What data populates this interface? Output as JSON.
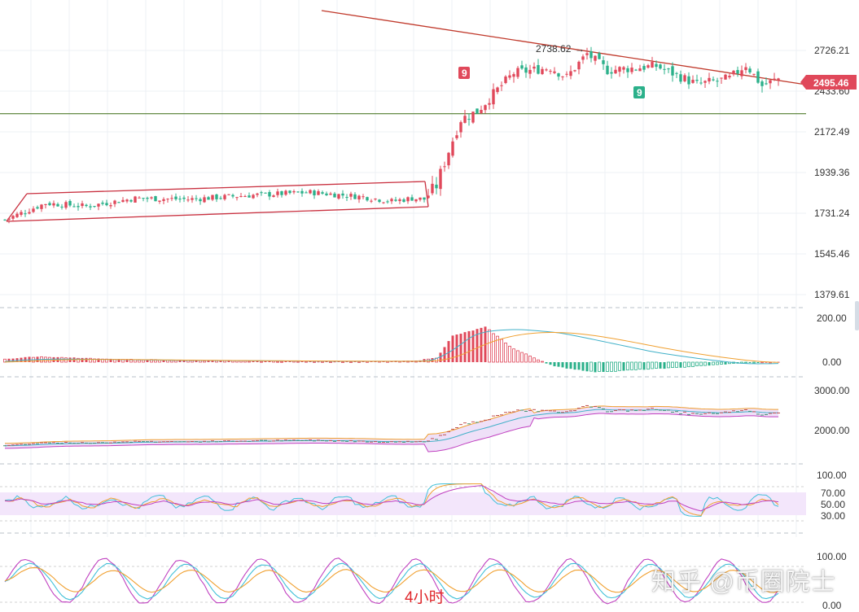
{
  "chart_data": {
    "type": "candlestick",
    "interval_label": "4小时",
    "watermark": "知乎 @币圈院士",
    "colors": {
      "up": "#e0485a",
      "down": "#2bb08a",
      "resistance": "#c0392b",
      "support": "#3a6b12",
      "channel": "#c93140",
      "price_tag": "#e0485a",
      "td_up": "#e0485a",
      "td_down": "#2bb08a",
      "macd_diff": "#f0a030",
      "macd_dea": "#40b0c8",
      "boll_fill": "#efe0f8",
      "rsi_band": "#f3e6fb"
    },
    "price_panel": {
      "y_ticks": [
        "2726.21",
        "2433.60",
        "2172.49",
        "1939.36",
        "1731.24",
        "1545.46",
        "1379.61"
      ],
      "y_scale": "log",
      "last_price": "2495.46",
      "high_annotation": "2738.62",
      "td_labels": [
        {
          "text": "9",
          "type": "up"
        },
        {
          "text": "9",
          "type": "down"
        }
      ],
      "support_level": 2285,
      "trend_segments": [
        {
          "name": "rising-channel",
          "candle_range": [
            1,
            102
          ]
        },
        {
          "name": "breakout-rally",
          "candle_range": [
            103,
            118
          ]
        },
        {
          "name": "top-range",
          "candle_range": [
            119,
            190
          ]
        }
      ],
      "anchors": [
        1700,
        1780,
        1765,
        1805,
        1800,
        1820,
        1835,
        1812,
        1790,
        1805,
        1800,
        1870,
        2250,
        2300,
        2560,
        2600,
        2530,
        2700,
        2580,
        2610,
        2480,
        2520,
        2620,
        2470,
        2520
      ],
      "anchor_positions": [
        0,
        10,
        20,
        32,
        45,
        60,
        75,
        88,
        95,
        100,
        103,
        106,
        112,
        116,
        125,
        134,
        138,
        143,
        148,
        160,
        170,
        178,
        182,
        186,
        190
      ]
    },
    "macd_panel": {
      "y_ticks": [
        "200.00",
        "0.00"
      ],
      "anchors": [
        15,
        25,
        12,
        5,
        3,
        5,
        20,
        120,
        160,
        60,
        -20,
        -45,
        -35,
        -25,
        -5,
        2
      ],
      "anchor_positions": [
        0,
        8,
        30,
        60,
        90,
        100,
        106,
        110,
        118,
        125,
        135,
        145,
        155,
        165,
        180,
        190
      ]
    },
    "boll_panel": {
      "y_ticks": [
        "3000.00",
        "2000.00"
      ]
    },
    "rsi_panel": {
      "y_ticks": [
        "100.00",
        "70.00",
        "50.00",
        "30.00"
      ],
      "band": [
        30,
        70
      ]
    },
    "kdj_panel": {
      "y_ticks": [
        "100.00",
        "0.00"
      ]
    }
  }
}
